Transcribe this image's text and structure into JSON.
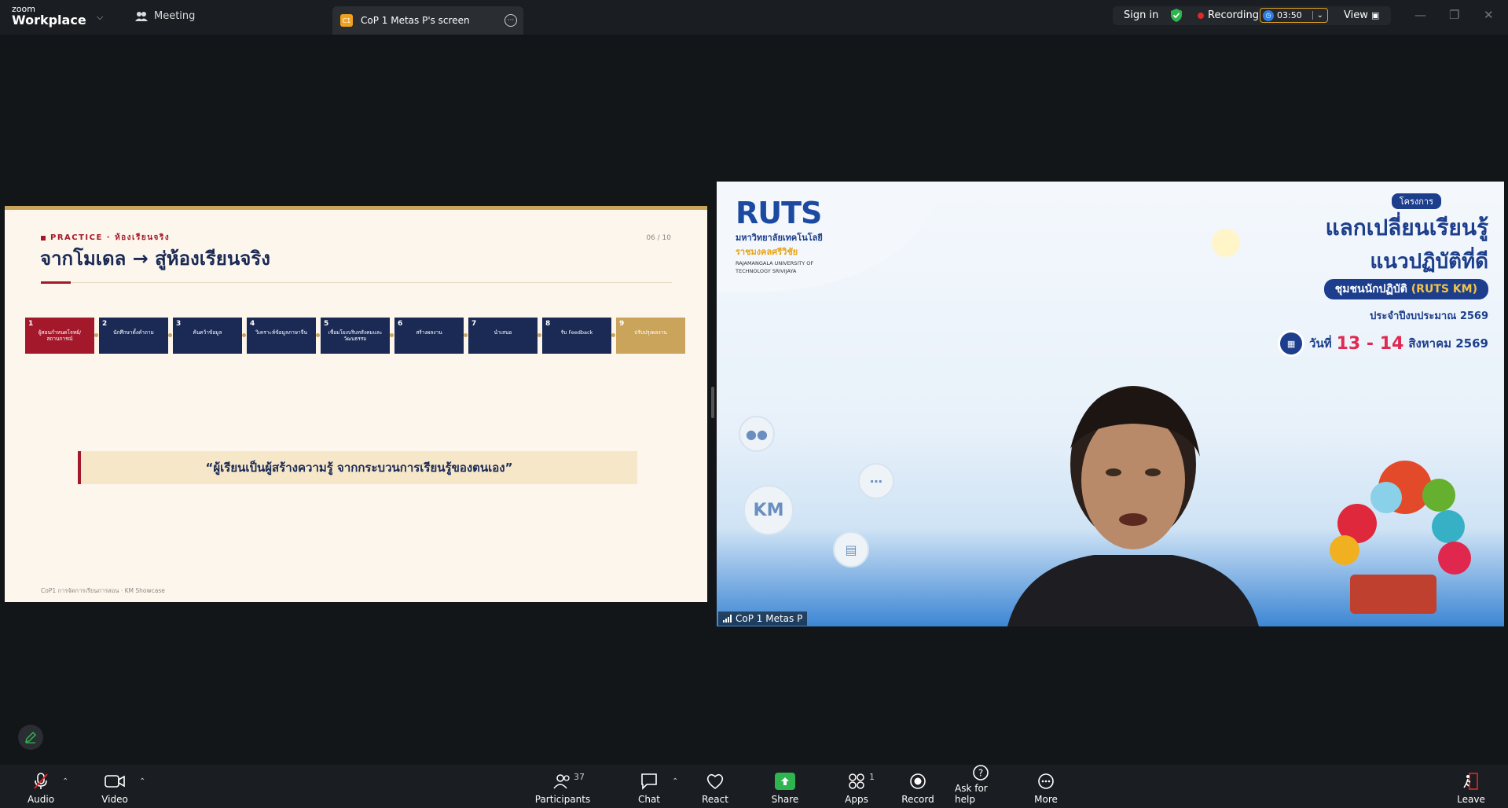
{
  "app": {
    "logo_small": "zoom",
    "logo_big": "Workplace",
    "meeting_menu": "Meeting",
    "tab_badge": "C1",
    "tab_title": "CoP 1 Metas P's screen",
    "sign_in": "Sign in",
    "recording": "Recording",
    "timer": "03:50",
    "view": "View"
  },
  "slide": {
    "kicker": "PRACTICE · ห้องเรียนจริง",
    "page": "06 / 10",
    "title": "จากโมเดล → สู่ห้องเรียนจริง",
    "steps": [
      {
        "n": "1",
        "label": "ผู้สอนกำหนดโจทย์/สถานการณ์"
      },
      {
        "n": "2",
        "label": "นักศึกษาตั้งคำถาม"
      },
      {
        "n": "3",
        "label": "ค้นคว้าข้อมูล"
      },
      {
        "n": "4",
        "label": "วิเคราะห์ข้อมูลภาษาจีน"
      },
      {
        "n": "5",
        "label": "เชื่อมโยงบริบทสังคมและวัฒนธรรม"
      },
      {
        "n": "6",
        "label": "สร้างผลงาน"
      },
      {
        "n": "7",
        "label": "นำเสนอ"
      },
      {
        "n": "8",
        "label": "รับ Feedback"
      },
      {
        "n": "9",
        "label": "ปรับปรุงผลงาน"
      }
    ],
    "quote": "“ผู้เรียนเป็นผู้สร้างความรู้ จากกระบวนการเรียนรู้ของตนเอง”",
    "footer": "CoP1 การจัดการเรียนการสอน · KM Showcase"
  },
  "video": {
    "brand": "RUTS",
    "univ_th1": "มหาวิทยาลัยเทคโนโลยี",
    "univ_th2": "ราชมงคลศรีวิชัย",
    "univ_en1": "RAJAMANGALA UNIVERSITY OF",
    "univ_en2": "TECHNOLOGY SRIVIJAYA",
    "project_chip": "โครงการ",
    "banner_l1": "แลกเปลี่ยนเรียนรู้",
    "banner_l2": "แนวปฏิบัติที่ดี",
    "banner_l3_a": "ชุมชนนักปฏิบัติ",
    "banner_l3_b": "(RUTS KM)",
    "banner_l4": "ประจำปีงบประมาณ 2569",
    "date_prefix": "วันที่",
    "date_range": "13 - 14",
    "date_suffix": "สิงหาคม 2569",
    "km": "KM",
    "participant_name": "CoP 1 Metas P"
  },
  "toolbar": {
    "audio": "Audio",
    "video": "Video",
    "participants": "Participants",
    "participants_count": "37",
    "chat": "Chat",
    "react": "React",
    "share": "Share",
    "apps": "Apps",
    "apps_count": "1",
    "record": "Record",
    "help": "Ask for help",
    "more": "More",
    "leave": "Leave"
  },
  "colors": {
    "accent_red": "#a3192b",
    "navy": "#1a2a55",
    "gold": "#c9a45a",
    "share_green": "#2fb550",
    "rec_red": "#e02828"
  }
}
